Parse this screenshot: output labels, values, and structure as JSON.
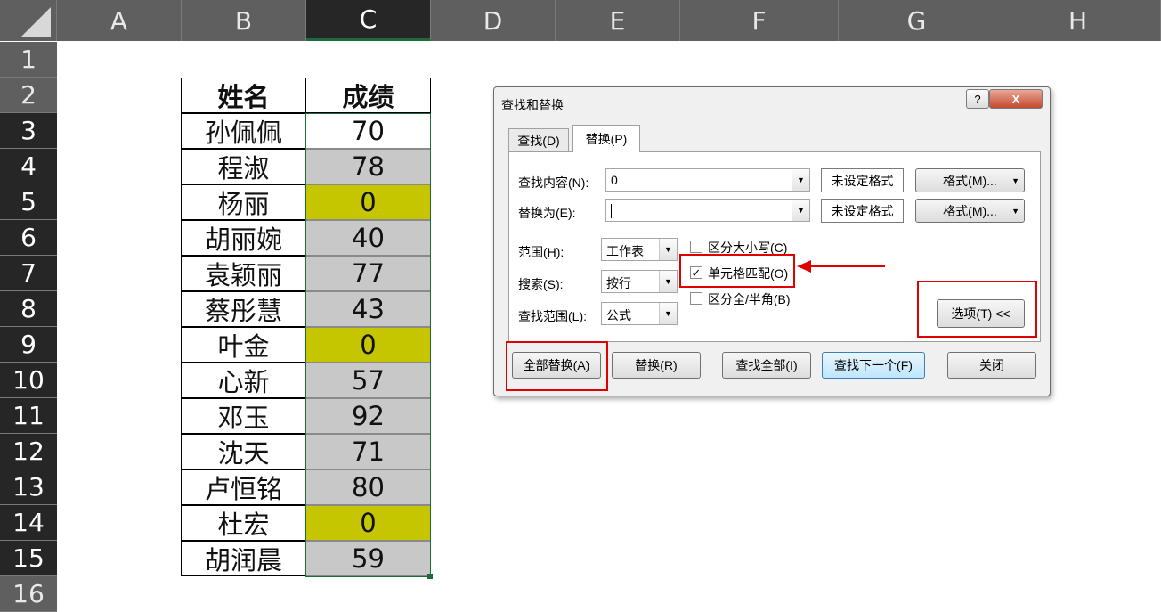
{
  "sheet": {
    "columns": [
      "A",
      "B",
      "C",
      "D",
      "E",
      "F",
      "G",
      "H"
    ],
    "selected_column": "C",
    "rows": [
      "1",
      "2",
      "3",
      "4",
      "5",
      "6",
      "7",
      "8",
      "9",
      "10",
      "11",
      "12",
      "13",
      "14",
      "15",
      "16"
    ],
    "table": {
      "header_name": "姓名",
      "header_score": "成绩",
      "records": [
        {
          "name": "孙佩佩",
          "score": "70",
          "fill": "white"
        },
        {
          "name": "程淑",
          "score": "78",
          "fill": "gray"
        },
        {
          "name": "杨丽",
          "score": "0",
          "fill": "yellow"
        },
        {
          "name": "胡丽婉",
          "score": "40",
          "fill": "gray"
        },
        {
          "name": "袁颖丽",
          "score": "77",
          "fill": "gray"
        },
        {
          "name": "蔡彤慧",
          "score": "43",
          "fill": "gray"
        },
        {
          "name": "叶金",
          "score": "0",
          "fill": "yellow"
        },
        {
          "name": "心新",
          "score": "57",
          "fill": "gray"
        },
        {
          "name": "邓玉",
          "score": "92",
          "fill": "gray"
        },
        {
          "name": "沈天",
          "score": "71",
          "fill": "gray"
        },
        {
          "name": "卢恒铭",
          "score": "80",
          "fill": "gray"
        },
        {
          "name": "杜宏",
          "score": "0",
          "fill": "yellow"
        },
        {
          "name": "胡润晨",
          "score": "59",
          "fill": "gray"
        }
      ]
    },
    "colors": {
      "gray": "#c8c8c8",
      "yellow": "#c5c500",
      "white": "#ffffff",
      "selection": "#1d6b3a",
      "highlight": "#e00000"
    }
  },
  "dialog": {
    "title": "查找和替换",
    "help_label": "?",
    "close_label": "X",
    "tabs": [
      "查找(D)",
      "替换(P)"
    ],
    "active_tab": "替换(P)",
    "find_label": "查找内容(N):",
    "find_value": "0",
    "replace_label": "替换为(E):",
    "replace_value": "",
    "no_format_label": "未设定格式",
    "format_button": "格式(M)...",
    "scope_label": "范围(H):",
    "scope_value": "工作表",
    "search_label": "搜索(S):",
    "search_value": "按行",
    "lookin_label": "查找范围(L):",
    "lookin_value": "公式",
    "match_case_label": "区分大小写(C)",
    "match_case_checked": false,
    "match_cell_label": "单元格匹配(O)",
    "match_cell_checked": true,
    "match_width_label": "区分全/半角(B)",
    "match_width_checked": false,
    "options_button": "选项(T) <<",
    "replace_all_button": "全部替换(A)",
    "replace_button": "替换(R)",
    "find_all_button": "查找全部(I)",
    "find_next_button": "查找下一个(F)",
    "close_button": "关闭",
    "check_mark": "✓",
    "dropdown_glyph": "▼"
  }
}
